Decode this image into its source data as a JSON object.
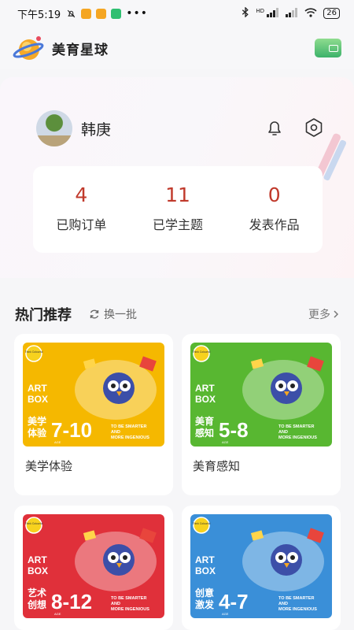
{
  "status_bar": {
    "time": "下午5:19",
    "battery": "26",
    "hd": "HD"
  },
  "header": {
    "app_name": "美育星球"
  },
  "profile": {
    "name": "韩庚",
    "stats": [
      {
        "value": "4",
        "label": "已购订单"
      },
      {
        "value": "11",
        "label": "已学主题"
      },
      {
        "value": "0",
        "label": "发表作品"
      }
    ]
  },
  "section": {
    "title": "热门推荐",
    "refresh_label": "换一批",
    "more_label": "更多"
  },
  "cards": [
    {
      "title": "美学体验",
      "tag": "美学\n体验",
      "age": "7-10",
      "bg": "#f5b800"
    },
    {
      "title": "美育感知",
      "tag": "美育\n感知",
      "age": "5-8",
      "bg": "#58b731"
    },
    {
      "title": "",
      "tag": "艺术\n创想",
      "age": "8-12",
      "bg": "#e0303a"
    },
    {
      "title": "",
      "tag": "创意\n激发",
      "age": "4-7",
      "bg": "#3a8fd8"
    }
  ],
  "art_box": {
    "line1": "ART",
    "line2": "BOX",
    "brand": "Think Colourful",
    "slogan1": "TO BE SMARTER",
    "slogan2": "AND",
    "slogan3": "MORE INGENIOUS",
    "age_unit": "AGE"
  },
  "colors": {
    "accent": "#c0392b",
    "card_bg": "#ffffff",
    "page_bg": "#f6f6f8"
  }
}
